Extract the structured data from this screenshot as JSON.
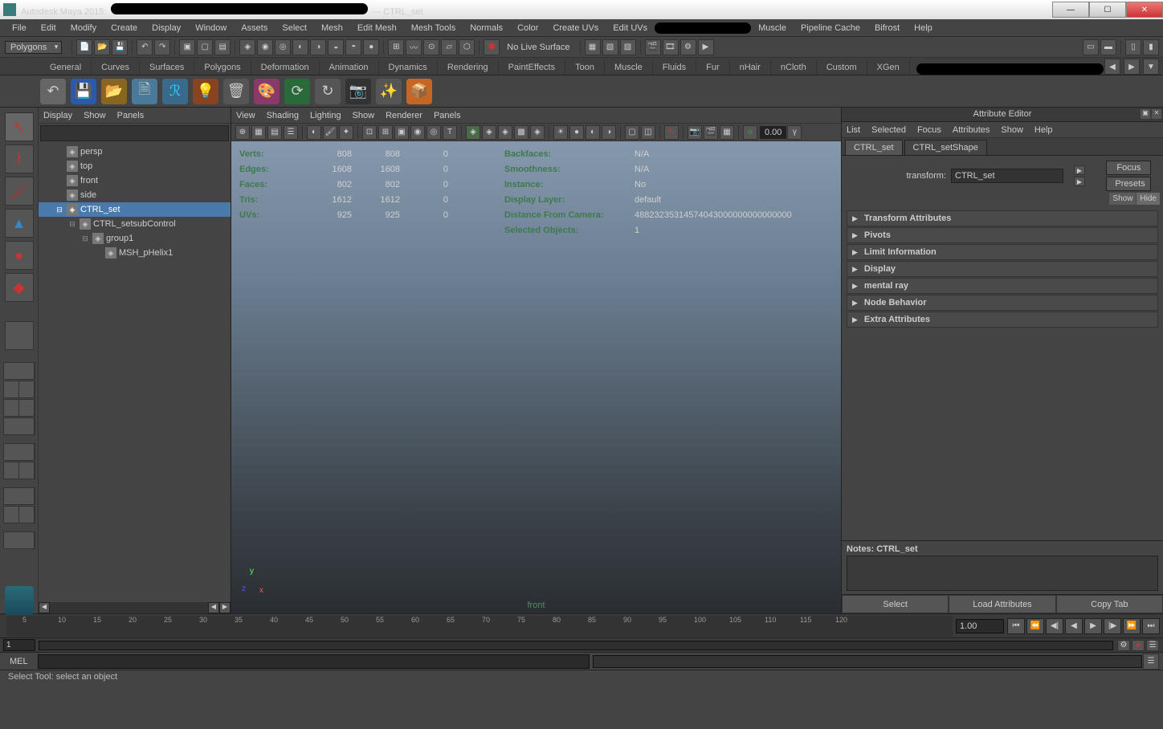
{
  "window": {
    "app": "Autodesk Maya 2015:",
    "suffix": "--- CTRL_set"
  },
  "menus": [
    "File",
    "Edit",
    "Modify",
    "Create",
    "Display",
    "Window",
    "Assets",
    "Select",
    "Mesh",
    "Edit Mesh",
    "Mesh Tools",
    "Normals",
    "Color",
    "Create UVs",
    "Edit UVs",
    "",
    "Muscle",
    "Pipeline Cache",
    "Bifrost",
    "Help"
  ],
  "mode_dropdown": "Polygons",
  "live_surface": "No Live Surface",
  "shelf_tabs": [
    "General",
    "Curves",
    "Surfaces",
    "Polygons",
    "Deformation",
    "Animation",
    "Dynamics",
    "Rendering",
    "PaintEffects",
    "Toon",
    "Muscle",
    "Fluids",
    "Fur",
    "nHair",
    "nCloth",
    "Custom",
    "XGen"
  ],
  "outliner": {
    "menus": [
      "Display",
      "Show",
      "Panels"
    ],
    "items": [
      {
        "name": "persp",
        "indent": 1
      },
      {
        "name": "top",
        "indent": 1
      },
      {
        "name": "front",
        "indent": 1
      },
      {
        "name": "side",
        "indent": 1
      },
      {
        "name": "CTRL_set",
        "indent": 1,
        "selected": true,
        "exp": "⊟"
      },
      {
        "name": "CTRL_setsubControl",
        "indent": 2,
        "exp": "⊟"
      },
      {
        "name": "group1",
        "indent": 3,
        "exp": "⊟"
      },
      {
        "name": "MSH_pHelix1",
        "indent": 4
      }
    ]
  },
  "viewport": {
    "menus": [
      "View",
      "Shading",
      "Lighting",
      "Show",
      "Renderer",
      "Panels"
    ],
    "exposure": "0.00",
    "camera": "front",
    "hud_left": [
      {
        "label": "Verts:",
        "v1": "808",
        "v2": "808",
        "v3": "0"
      },
      {
        "label": "Edges:",
        "v1": "1608",
        "v2": "1608",
        "v3": "0"
      },
      {
        "label": "Faces:",
        "v1": "802",
        "v2": "802",
        "v3": "0"
      },
      {
        "label": "Tris:",
        "v1": "1612",
        "v2": "1612",
        "v3": "0"
      },
      {
        "label": "UVs:",
        "v1": "925",
        "v2": "925",
        "v3": "0"
      }
    ],
    "hud_right": [
      {
        "label": "Backfaces:",
        "val": "N/A"
      },
      {
        "label": "Smoothness:",
        "val": "N/A"
      },
      {
        "label": "Instance:",
        "val": "No"
      },
      {
        "label": "Display Layer:",
        "val": "default"
      },
      {
        "label": "Distance From Camera:",
        "val": "48823235314574043000000000000000"
      },
      {
        "label": "Selected Objects:",
        "val": "1"
      }
    ]
  },
  "attr": {
    "title": "Attribute Editor",
    "menus": [
      "List",
      "Selected",
      "Focus",
      "Attributes",
      "Show",
      "Help"
    ],
    "tabs": [
      "CTRL_set",
      "CTRL_setShape"
    ],
    "transform_label": "transform:",
    "transform_value": "CTRL_set",
    "buttons": {
      "focus": "Focus",
      "presets": "Presets",
      "show": "Show",
      "hide": "Hide"
    },
    "sections": [
      "Transform Attributes",
      "Pivots",
      "Limit Information",
      "Display",
      "mental ray",
      "Node Behavior",
      "Extra Attributes"
    ],
    "notes_label": "Notes: CTRL_set",
    "footer": [
      "Select",
      "Load Attributes",
      "Copy Tab"
    ]
  },
  "timeline": {
    "ticks": [
      5,
      10,
      15,
      20,
      25,
      30,
      35,
      40,
      45,
      50,
      55,
      60,
      65,
      70,
      75,
      80,
      85,
      90,
      95,
      100,
      105,
      110,
      115,
      120
    ],
    "current": "1.00",
    "range_start": "1"
  },
  "cmd": {
    "lang": "MEL"
  },
  "status": "Select Tool: select an object"
}
